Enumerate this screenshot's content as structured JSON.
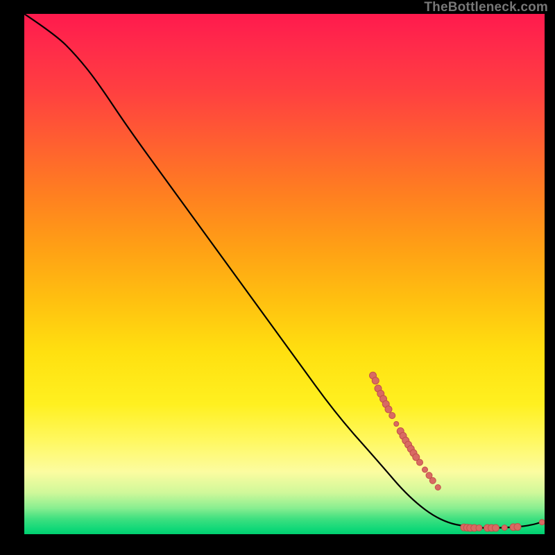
{
  "watermark": "TheBottleneck.com",
  "chart_data": {
    "type": "line",
    "title": "",
    "xlabel": "",
    "ylabel": "",
    "xlim": [
      0,
      100
    ],
    "ylim": [
      0,
      100
    ],
    "curve": [
      {
        "x": 0,
        "y": 100
      },
      {
        "x": 6,
        "y": 96
      },
      {
        "x": 10,
        "y": 92
      },
      {
        "x": 14,
        "y": 87
      },
      {
        "x": 20,
        "y": 78
      },
      {
        "x": 28,
        "y": 67
      },
      {
        "x": 36,
        "y": 56
      },
      {
        "x": 44,
        "y": 45
      },
      {
        "x": 52,
        "y": 34
      },
      {
        "x": 60,
        "y": 23
      },
      {
        "x": 68,
        "y": 14
      },
      {
        "x": 74,
        "y": 7
      },
      {
        "x": 80,
        "y": 2.5
      },
      {
        "x": 86,
        "y": 1.2
      },
      {
        "x": 92,
        "y": 1.2
      },
      {
        "x": 97,
        "y": 1.6
      },
      {
        "x": 100,
        "y": 2.5
      }
    ],
    "points": [
      {
        "x": 67,
        "y": 30.5,
        "r": 5
      },
      {
        "x": 67.5,
        "y": 29.5,
        "r": 5
      },
      {
        "x": 68,
        "y": 28,
        "r": 5
      },
      {
        "x": 68.5,
        "y": 27,
        "r": 5
      },
      {
        "x": 69,
        "y": 26,
        "r": 5
      },
      {
        "x": 69.5,
        "y": 25,
        "r": 5
      },
      {
        "x": 70,
        "y": 24,
        "r": 5
      },
      {
        "x": 70.7,
        "y": 22.8,
        "r": 4.5
      },
      {
        "x": 71.5,
        "y": 21.2,
        "r": 3.5
      },
      {
        "x": 72.3,
        "y": 19.8,
        "r": 5
      },
      {
        "x": 72.8,
        "y": 18.9,
        "r": 5
      },
      {
        "x": 73.3,
        "y": 18,
        "r": 5
      },
      {
        "x": 73.8,
        "y": 17.2,
        "r": 5
      },
      {
        "x": 74.3,
        "y": 16.4,
        "r": 5
      },
      {
        "x": 74.8,
        "y": 15.6,
        "r": 5
      },
      {
        "x": 75.3,
        "y": 14.8,
        "r": 5
      },
      {
        "x": 76,
        "y": 13.8,
        "r": 4.5
      },
      {
        "x": 77,
        "y": 12.4,
        "r": 4
      },
      {
        "x": 77.8,
        "y": 11.3,
        "r": 4.5
      },
      {
        "x": 78.5,
        "y": 10.3,
        "r": 4.5
      },
      {
        "x": 79.5,
        "y": 9,
        "r": 4
      },
      {
        "x": 84.5,
        "y": 1.3,
        "r": 5
      },
      {
        "x": 85.1,
        "y": 1.25,
        "r": 5
      },
      {
        "x": 85.7,
        "y": 1.2,
        "r": 5
      },
      {
        "x": 86.5,
        "y": 1.2,
        "r": 5
      },
      {
        "x": 87.4,
        "y": 1.2,
        "r": 4.5
      },
      {
        "x": 89,
        "y": 1.2,
        "r": 5
      },
      {
        "x": 89.8,
        "y": 1.2,
        "r": 5
      },
      {
        "x": 90.6,
        "y": 1.2,
        "r": 5
      },
      {
        "x": 92.3,
        "y": 1.25,
        "r": 4
      },
      {
        "x": 94,
        "y": 1.35,
        "r": 5
      },
      {
        "x": 94.8,
        "y": 1.4,
        "r": 5
      },
      {
        "x": 99.5,
        "y": 2.3,
        "r": 4
      }
    ]
  }
}
